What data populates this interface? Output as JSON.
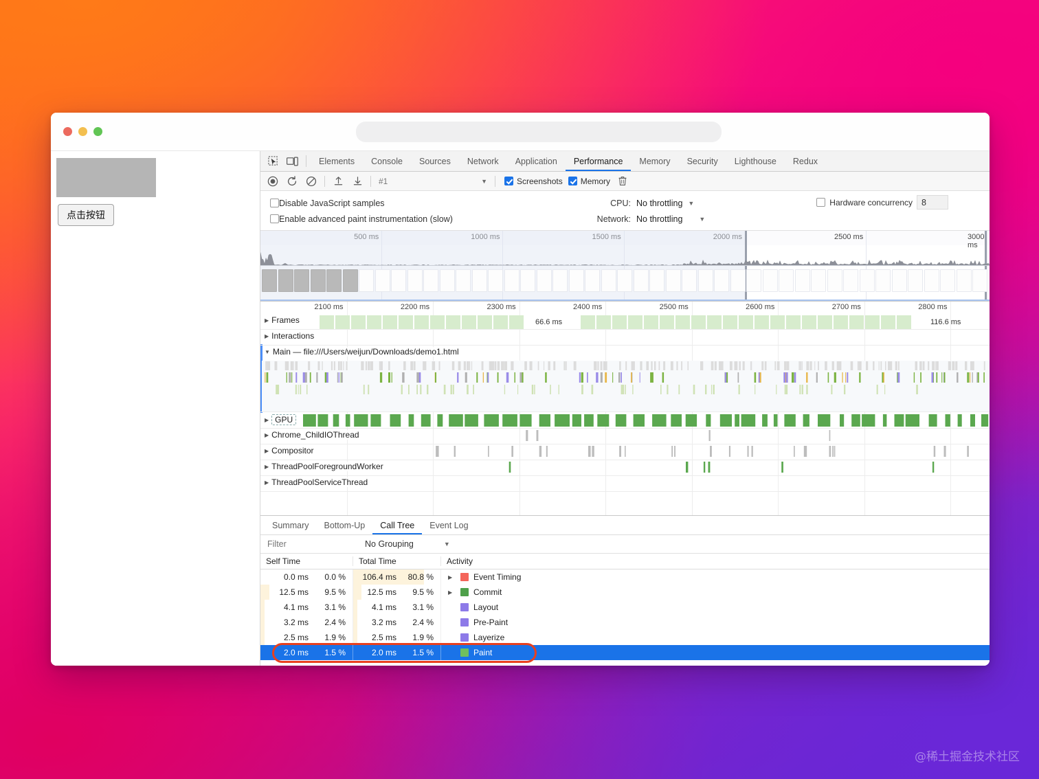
{
  "window": {
    "traffic_lights": [
      "close",
      "minimize",
      "maximize"
    ],
    "url_value": "",
    "url_placeholder": ""
  },
  "page": {
    "button_label": "点击按钮"
  },
  "devtools": {
    "tabs": [
      {
        "label": "Elements",
        "active": false
      },
      {
        "label": "Console",
        "active": false
      },
      {
        "label": "Sources",
        "active": false
      },
      {
        "label": "Network",
        "active": false
      },
      {
        "label": "Application",
        "active": false
      },
      {
        "label": "Performance",
        "active": true
      },
      {
        "label": "Memory",
        "active": false
      },
      {
        "label": "Security",
        "active": false
      },
      {
        "label": "Lighthouse",
        "active": false
      },
      {
        "label": "Redux",
        "active": false
      }
    ],
    "left_icons": [
      "inspect-element-icon",
      "device-toolbar-icon"
    ],
    "controls": {
      "record_icon": "record-icon",
      "reload_icon": "reload-record-icon",
      "clear_icon": "clear-icon",
      "upload_icon": "load-profile-icon",
      "download_icon": "save-profile-icon",
      "profile_selected": "#1",
      "screenshots_label": "Screenshots",
      "screenshots_checked": true,
      "memory_label": "Memory",
      "memory_checked": true,
      "trash_icon": "trash-icon"
    },
    "settings": {
      "disable_js_samples_label": "Disable JavaScript samples",
      "disable_js_samples_checked": false,
      "advanced_paint_label": "Enable advanced paint instrumentation (slow)",
      "advanced_paint_checked": false,
      "cpu_label": "CPU:",
      "cpu_value": "No throttling",
      "network_label": "Network:",
      "network_value": "No throttling",
      "hardware_concurrency_label": "Hardware concurrency",
      "hardware_concurrency_checked": false,
      "hardware_concurrency_value": "8"
    }
  },
  "overview": {
    "ticks": [
      "500 ms",
      "1000 ms",
      "1500 ms",
      "2000 ms",
      "2500 ms",
      "3000 ms"
    ],
    "selection_start_label": "2000 ms",
    "selection_end_label": "3000 ms"
  },
  "flamechart": {
    "ticks": [
      "2100 ms",
      "2200 ms",
      "2300 ms",
      "2400 ms",
      "2500 ms",
      "2600 ms",
      "2700 ms",
      "2800 ms"
    ],
    "tracks": [
      {
        "name": "Frames",
        "expanded": false
      },
      {
        "name": "Interactions",
        "expanded": false
      },
      {
        "name": "Main — file:///Users/weijun/Downloads/demo1.html",
        "expanded": true
      },
      {
        "name": "GPU",
        "expanded": false
      },
      {
        "name": "Chrome_ChildIOThread",
        "expanded": false
      },
      {
        "name": "Compositor",
        "expanded": false
      },
      {
        "name": "ThreadPoolForegroundWorker",
        "expanded": false
      },
      {
        "name": "ThreadPoolServiceThread",
        "expanded": false
      }
    ],
    "frame_durations": [
      "66.6 ms",
      "116.6 ms"
    ]
  },
  "bottom_panel": {
    "tabs": [
      {
        "label": "Summary",
        "active": false
      },
      {
        "label": "Bottom-Up",
        "active": false
      },
      {
        "label": "Call Tree",
        "active": true
      },
      {
        "label": "Event Log",
        "active": false
      }
    ],
    "filter_placeholder": "Filter",
    "filter_value": "",
    "grouping_label": "No Grouping",
    "columns": [
      "Self Time",
      "Total Time",
      "Activity"
    ],
    "rows": [
      {
        "self_ms": "0.0 ms",
        "self_pct": "0.0 %",
        "total_ms": "106.4 ms",
        "total_pct": "80.8 %",
        "activity": "Event Timing",
        "color": "#f4655a",
        "expandable": true,
        "selected": false,
        "self_bar": 0.0,
        "total_bar": 0.808
      },
      {
        "self_ms": "12.5 ms",
        "self_pct": "9.5 %",
        "total_ms": "12.5 ms",
        "total_pct": "9.5 %",
        "activity": "Commit",
        "color": "#4ea04a",
        "expandable": true,
        "selected": false,
        "self_bar": 0.095,
        "total_bar": 0.095
      },
      {
        "self_ms": "4.1 ms",
        "self_pct": "3.1 %",
        "total_ms": "4.1 ms",
        "total_pct": "3.1 %",
        "activity": "Layout",
        "color": "#8d7ae8",
        "expandable": false,
        "selected": false,
        "self_bar": 0.031,
        "total_bar": 0.031
      },
      {
        "self_ms": "3.2 ms",
        "self_pct": "2.4 %",
        "total_ms": "3.2 ms",
        "total_pct": "2.4 %",
        "activity": "Pre-Paint",
        "color": "#8d7ae8",
        "expandable": false,
        "selected": false,
        "self_bar": 0.024,
        "total_bar": 0.024
      },
      {
        "self_ms": "2.5 ms",
        "self_pct": "1.9 %",
        "total_ms": "2.5 ms",
        "total_pct": "1.9 %",
        "activity": "Layerize",
        "color": "#8d7ae8",
        "expandable": false,
        "selected": false,
        "self_bar": 0.019,
        "total_bar": 0.019
      },
      {
        "self_ms": "2.0 ms",
        "self_pct": "1.5 %",
        "total_ms": "2.0 ms",
        "total_pct": "1.5 %",
        "activity": "Paint",
        "color": "#6fbf5e",
        "expandable": false,
        "selected": true,
        "self_bar": 0.015,
        "total_bar": 0.015
      }
    ]
  },
  "annotation": {
    "highlight_target": "Paint row",
    "highlight_color": "#e8401f"
  },
  "watermark": {
    "text": "@稀土掘金技术社区"
  },
  "colors": {
    "accent": "#1a73e8",
    "selection_row": "#1a73e8",
    "frame_green": "#d7eccd",
    "gpu_green": "#5ba84f",
    "annotation_red": "#e8401f"
  }
}
